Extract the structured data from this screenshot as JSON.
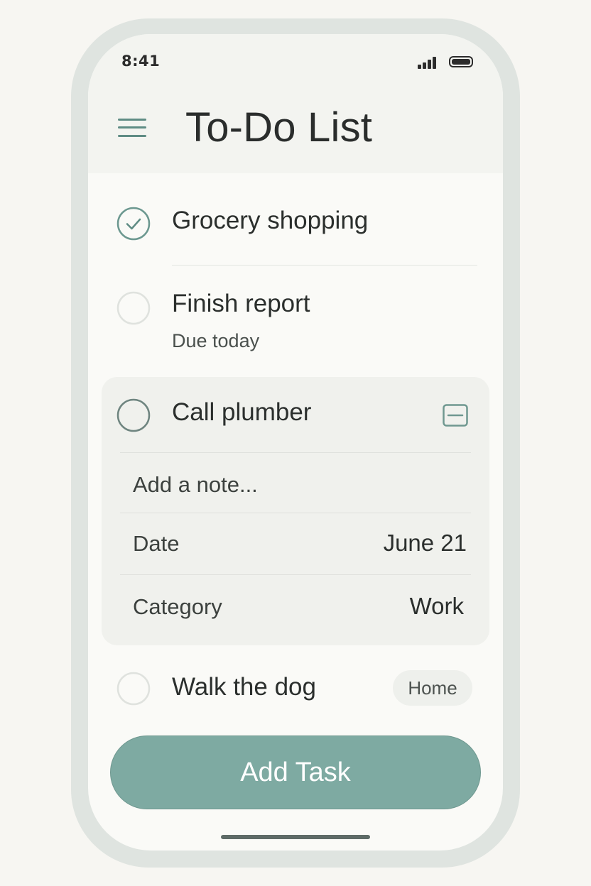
{
  "status_bar": {
    "time": "8:41",
    "signal_icon": "signal-bars-icon",
    "battery_icon": "battery-icon"
  },
  "header": {
    "menu_icon": "hamburger-menu-icon",
    "title": "To-Do List"
  },
  "tasks": [
    {
      "label": "Grocery shopping",
      "completed": true,
      "icon": "checkmark-circle-icon"
    },
    {
      "label": "Finish report",
      "subtitle": "Due today",
      "completed": false
    },
    {
      "label": "Call plumber",
      "completed": false,
      "expanded": true,
      "collapse_icon": "minus-square-icon",
      "note_placeholder": "Add a note...",
      "details": [
        {
          "label": "Date",
          "value": "June 21"
        },
        {
          "label": "Category",
          "value": "Work"
        }
      ]
    },
    {
      "label": "Walk the dog",
      "tag": "Home",
      "completed": false
    }
  ],
  "add_button": {
    "label": "Add Task"
  },
  "colors": {
    "accent": "#7eaaa2",
    "icon_green": "#5f8c84",
    "background": "#fafaf7",
    "frame": "#dfe4e0"
  }
}
